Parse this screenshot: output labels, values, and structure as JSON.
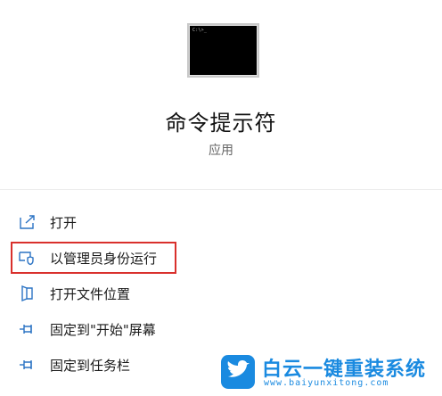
{
  "app": {
    "title": "命令提示符",
    "subtitle": "应用",
    "thumbnail_text": "C:\\>_"
  },
  "menu": {
    "items": [
      {
        "label": "打开",
        "icon": "open-icon"
      },
      {
        "label": "以管理员身份运行",
        "icon": "shield-icon",
        "highlighted": true
      },
      {
        "label": "打开文件位置",
        "icon": "folder-location-icon"
      },
      {
        "label": "固定到\"开始\"屏幕",
        "icon": "pin-icon"
      },
      {
        "label": "固定到任务栏",
        "icon": "pin-icon"
      }
    ]
  },
  "watermark": {
    "title": "白云一键重装系统",
    "url": "www.baiyunxitong.com"
  },
  "colors": {
    "accent": "#2b73c4",
    "highlight_border": "#d9302c",
    "watermark": "#1a8ae0"
  }
}
